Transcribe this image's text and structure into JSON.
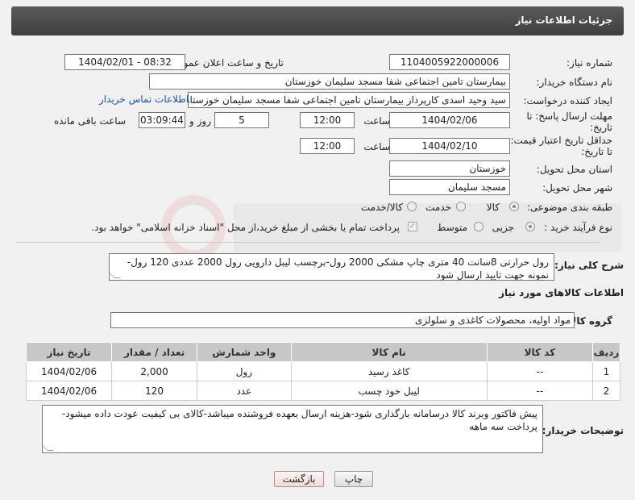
{
  "header": {
    "title": "جزئیات اطلاعات نیاز"
  },
  "form": {
    "need_number_label": "شماره نیاز:",
    "need_number": "1104005922000006",
    "announce_label": "تاریخ و ساعت اعلان عمومی:",
    "announce_value": "1404/02/01 - 08:32",
    "buyer_org_label": "نام دستگاه خریدار:",
    "buyer_org": "بیمارستان تامین اجتماعی شفا مسجد سلیمان خوزستان",
    "creator_label": "ایجاد کننده درخواست:",
    "creator": "سید وحید اسدی کارپرداز بیمارستان تامین اجتماعی شفا مسجد سلیمان خوزستان",
    "contact_link": "اطلاعات تماس خریدار",
    "reply_deadline_label_1": "مهلت ارسال پاسخ: تا",
    "reply_deadline_label_2": "تاریخ:",
    "reply_date": "1404/02/06",
    "time_label": "ساعت",
    "reply_time": "12:00",
    "days_value": "5",
    "days_label": "روز و",
    "remaining_time": "03:09:44",
    "remaining_label": "ساعت باقی مانده",
    "price_validity_label_1": "حداقل تاریخ اعتبار قیمت:",
    "price_validity_label_2": "تا تاریخ:",
    "price_date": "1404/02/10",
    "price_time": "12:00",
    "province_label": "استان محل تحویل:",
    "province": "خوزستان",
    "city_label": "شهر محل تحویل:",
    "city": "مسجد سلیمان",
    "category_label": "طبقه بندی موضوعی:",
    "category_goods": "کالا",
    "category_service": "خدمت",
    "category_both": "کالا/خدمت",
    "process_label": "نوع فرآیند خرید :",
    "process_partial": "جزیی",
    "process_medium": "متوسط",
    "payment_note": "پرداخت تمام یا بخشی از مبلغ خرید،از محل \"اسناد خزانه اسلامی\" خواهد بود.",
    "summary_label": "شرح کلی نیاز:",
    "summary": "رول حرارتی 8سانت 40 متری چاپ مشکی 2000 رول-برچسب لیبل دارویی رول 2000 عددی 120 رول-نمونه جهت تایید ارسال شود",
    "goods_info_title": "اطلاعات کالاهای مورد نیاز",
    "goods_group_label": "گروه کالا:",
    "goods_group": "مواد اولیه، محصولات کاغذی و سلولزی",
    "buyer_notes_label": "توضیحات خریدار:",
    "buyer_notes": "پیش فاکتور وبرند کالا درسامانه بارگذاری شود-هزینه ارسال بعهده فروشنده میباشد-کالای بی کیفیت عودت داده میشود-پرداخت سه ماهه"
  },
  "table": {
    "headers": [
      "ردیف",
      "کد کالا",
      "نام کالا",
      "واحد شمارش",
      "تعداد / مقدار",
      "تاریخ نیاز"
    ],
    "rows": [
      [
        "1",
        "--",
        "کاغذ رسید",
        "رول",
        "2,000",
        "1404/02/06"
      ],
      [
        "2",
        "--",
        "لیبل خود چسب",
        "عدد",
        "120",
        "1404/02/06"
      ]
    ]
  },
  "buttons": {
    "print": "چاپ",
    "back": "بازگشت"
  }
}
